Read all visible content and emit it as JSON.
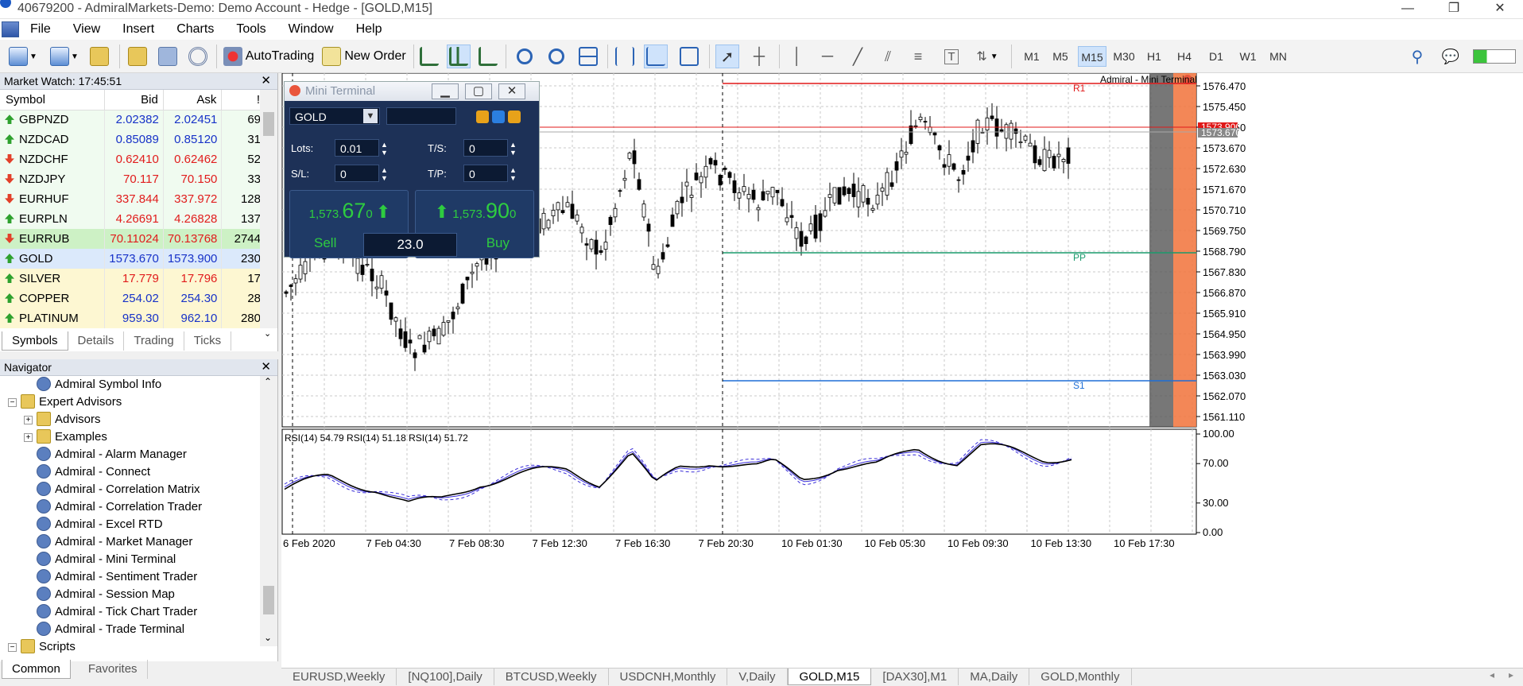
{
  "window": {
    "title": "40679200 - AdmiralMarkets-Demo: Demo Account - Hedge - [GOLD,M15]",
    "controls": [
      "—",
      "❐",
      "✕"
    ]
  },
  "menu": [
    "File",
    "View",
    "Insert",
    "Charts",
    "Tools",
    "Window",
    "Help"
  ],
  "toolbar": {
    "autotrading": "AutoTrading",
    "new_order": "New Order",
    "timeframes": [
      "M1",
      "M5",
      "M15",
      "M30",
      "H1",
      "H4",
      "D1",
      "W1",
      "MN"
    ],
    "active_timeframe": "M15"
  },
  "market_watch": {
    "title": "Market Watch: 17:45:51",
    "columns": [
      "Symbol",
      "Bid",
      "Ask",
      "!"
    ],
    "rows": [
      {
        "symbol": "GBPNZD",
        "bid": "2.02382",
        "ask": "2.02451",
        "spread": "69",
        "dir": "up",
        "color": "blue"
      },
      {
        "symbol": "NZDCAD",
        "bid": "0.85089",
        "ask": "0.85120",
        "spread": "31",
        "dir": "up",
        "color": "blue"
      },
      {
        "symbol": "NZDCHF",
        "bid": "0.62410",
        "ask": "0.62462",
        "spread": "52",
        "dir": "down",
        "color": "red"
      },
      {
        "symbol": "NZDJPY",
        "bid": "70.117",
        "ask": "70.150",
        "spread": "33",
        "dir": "down",
        "color": "red"
      },
      {
        "symbol": "EURHUF",
        "bid": "337.844",
        "ask": "337.972",
        "spread": "128",
        "dir": "down",
        "color": "red"
      },
      {
        "symbol": "EURPLN",
        "bid": "4.26691",
        "ask": "4.26828",
        "spread": "137",
        "dir": "up",
        "color": "red"
      },
      {
        "symbol": "EURRUB",
        "bid": "70.11024",
        "ask": "70.13768",
        "spread": "2744",
        "dir": "down",
        "color": "red"
      },
      {
        "symbol": "GOLD",
        "bid": "1573.670",
        "ask": "1573.900",
        "spread": "230",
        "dir": "up",
        "color": "blue"
      },
      {
        "symbol": "SILVER",
        "bid": "17.779",
        "ask": "17.796",
        "spread": "17",
        "dir": "up",
        "color": "red"
      },
      {
        "symbol": "COPPER",
        "bid": "254.02",
        "ask": "254.30",
        "spread": "28",
        "dir": "up",
        "color": "blue"
      },
      {
        "symbol": "PLATINUM",
        "bid": "959.30",
        "ask": "962.10",
        "spread": "280",
        "dir": "up",
        "color": "blue"
      }
    ],
    "tabs": [
      "Symbols",
      "Details",
      "Trading",
      "Ticks"
    ],
    "active_tab": "Symbols"
  },
  "navigator": {
    "title": "Navigator",
    "items": [
      {
        "label": "Admiral Symbol Info",
        "level": 3
      },
      {
        "label": "Expert Advisors",
        "level": 1
      },
      {
        "label": "Advisors",
        "level": 2
      },
      {
        "label": "Examples",
        "level": 2
      },
      {
        "label": "Admiral - Alarm Manager",
        "level": 3
      },
      {
        "label": "Admiral - Connect",
        "level": 3
      },
      {
        "label": "Admiral - Correlation Matrix",
        "level": 3
      },
      {
        "label": "Admiral - Correlation Trader",
        "level": 3
      },
      {
        "label": "Admiral - Excel RTD",
        "level": 3
      },
      {
        "label": "Admiral - Market Manager",
        "level": 3
      },
      {
        "label": "Admiral - Mini Terminal",
        "level": 3
      },
      {
        "label": "Admiral - Sentiment Trader",
        "level": 3
      },
      {
        "label": "Admiral - Session Map",
        "level": 3
      },
      {
        "label": "Admiral - Tick Chart Trader",
        "level": 3
      },
      {
        "label": "Admiral - Trade Terminal",
        "level": 3
      },
      {
        "label": "Scripts",
        "level": 1
      }
    ],
    "tabs": [
      "Common",
      "Favorites"
    ],
    "active_tab": "Common"
  },
  "mini_terminal": {
    "title": "Mini Terminal",
    "symbol": "GOLD",
    "lots_label": "Lots:",
    "lots": "0.01",
    "ts_label": "T/S:",
    "ts": "0",
    "sl_label": "S/L:",
    "sl": "0",
    "tp_label": "T/P:",
    "tp": "0",
    "sell_price_main": "1,573.",
    "sell_price_big": "67",
    "sell_price_small": "0",
    "buy_price_main": "1,573.",
    "buy_price_big": "90",
    "buy_price_small": "0",
    "sell_label": "Sell",
    "buy_label": "Buy",
    "spread": "23.0"
  },
  "chart": {
    "symbol": "GOLD",
    "timeframe": "M15",
    "watermark": "Admiral - Mini Terminal",
    "price_axis": [
      "1576.470",
      "1575.450",
      "1574.550",
      "1573.670",
      "1572.630",
      "1571.670",
      "1570.710",
      "1569.750",
      "1568.790",
      "1567.830",
      "1566.870",
      "1565.910",
      "1564.950",
      "1563.990",
      "1563.030",
      "1562.070",
      "1561.110"
    ],
    "current_price_label": "1573.670",
    "red_price_label": "1573.900",
    "levels": [
      {
        "name": "R1",
        "color": "#e01818"
      },
      {
        "name": "PP",
        "color": "#1a9a6c"
      },
      {
        "name": "S1",
        "color": "#1e6fd6"
      }
    ],
    "time_axis": [
      "6 Feb 2020",
      "7 Feb 04:30",
      "7 Feb 08:30",
      "7 Feb 12:30",
      "7 Feb 16:30",
      "7 Feb 20:30",
      "10 Feb 01:30",
      "10 Feb 05:30",
      "10 Feb 09:30",
      "10 Feb 13:30",
      "10 Feb 17:30"
    ],
    "rsi_label": "RSI(14) 54.79 RSI(14) 51.18 RSI(14) 51.72",
    "rsi_axis": [
      "100.00",
      "70.00",
      "30.00",
      "0.00"
    ]
  },
  "chart_tabs": [
    "EURUSD,Weekly",
    "[NQ100],Daily",
    "BTCUSD,Weekly",
    "USDCNH,Monthly",
    "V,Daily",
    "GOLD,M15",
    "[DAX30],M1",
    "MA,Daily",
    "GOLD,Monthly"
  ],
  "active_chart_tab": "GOLD,M15"
}
